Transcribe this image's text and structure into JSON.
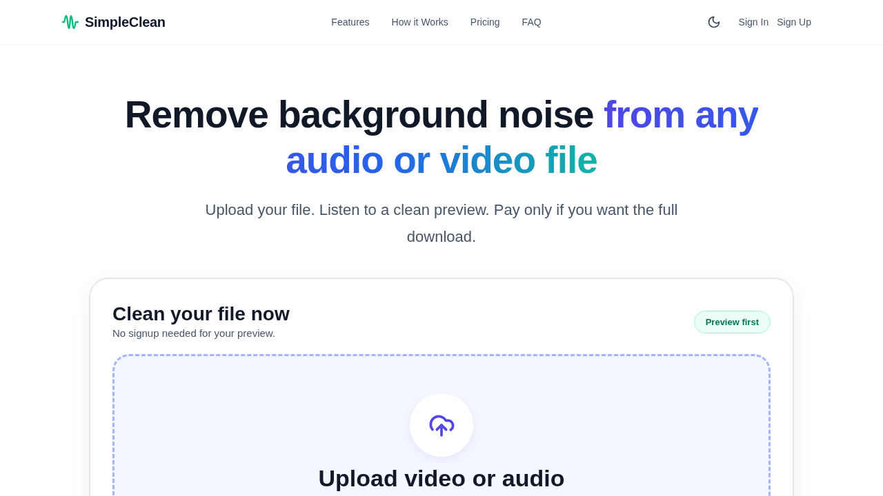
{
  "brand": {
    "name": "SimpleClean"
  },
  "nav": {
    "links": [
      "Features",
      "How it Works",
      "Pricing",
      "FAQ"
    ],
    "actions": [
      "Sign In",
      "Sign Up"
    ]
  },
  "hero": {
    "headline": {
      "plain": "Remove background noise ",
      "highlight": "from any audio or video file"
    },
    "subtitle": "Upload your file. Listen to a clean preview. Pay only if you want the full download."
  },
  "card": {
    "title": "Clean your file now",
    "subtitle": "No signup needed for your preview.",
    "badge": "Preview first",
    "dropzone": {
      "title": "Upload video or audio"
    }
  }
}
